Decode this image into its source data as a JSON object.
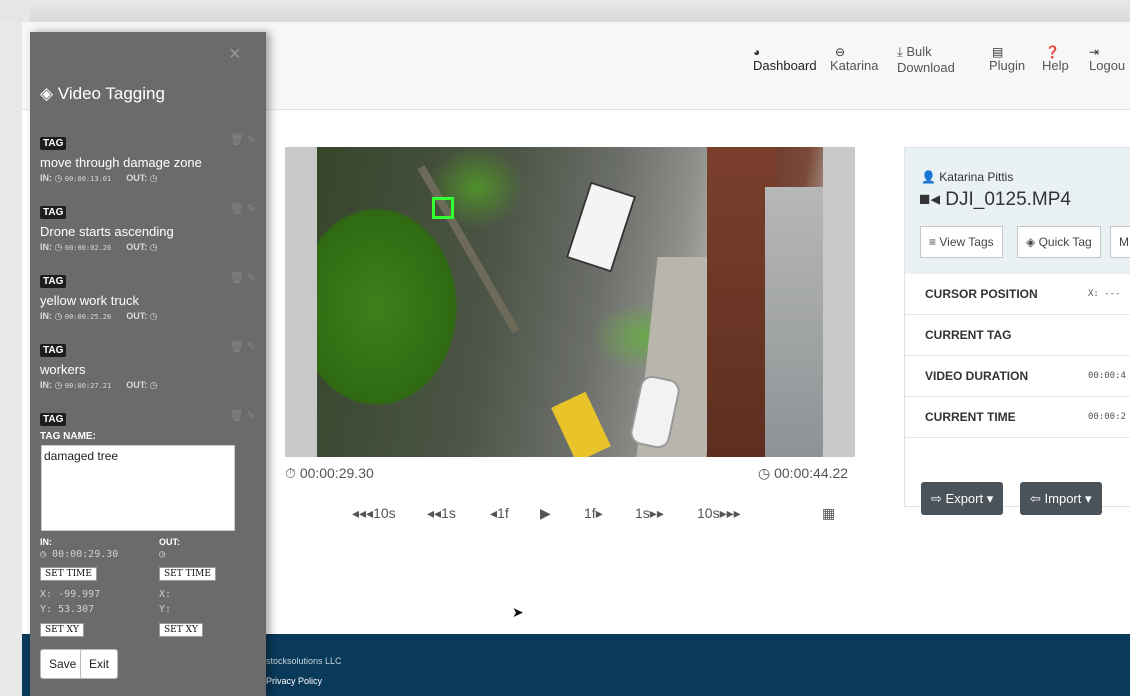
{
  "nav": {
    "dashboard": "Dashboard",
    "user": "Katarina",
    "bulk_line1": "Bulk",
    "bulk_line2": "Download",
    "plugin": "Plugin",
    "help": "Help",
    "logout": "Logou"
  },
  "sidebar": {
    "close": "×",
    "title": "Video Tagging",
    "tags": [
      {
        "badge": "TAG",
        "name": "move through damage zone",
        "in_label": "IN:",
        "in_time": "00:00:13.01",
        "out_label": "OUT:"
      },
      {
        "badge": "TAG",
        "name": "Drone starts ascending",
        "in_label": "IN:",
        "in_time": "00:00:02.26",
        "out_label": "OUT:"
      },
      {
        "badge": "TAG",
        "name": "yellow work truck",
        "in_label": "IN:",
        "in_time": "00:00:25.26",
        "out_label": "OUT:"
      },
      {
        "badge": "TAG",
        "name": "workers",
        "in_label": "IN:",
        "in_time": "00:00:27.21",
        "out_label": "OUT:"
      }
    ],
    "edit": {
      "badge": "TAG",
      "name_label": "TAG NAME:",
      "name_value": "damaged tree",
      "in_label": "IN:",
      "in_value": "00:00:29.30",
      "out_label": "OUT:",
      "set_time": "SET TIME",
      "x_label": "X:",
      "x_value": "-99.997",
      "y_label": "Y:",
      "y_value": "53.307",
      "set_xy": "SET XY",
      "save": "Save",
      "exit": "Exit"
    }
  },
  "player": {
    "current_time": "00:00:29.30",
    "total_time": "00:00:44.22",
    "controls": {
      "back10": "10s",
      "back1s": "1s",
      "back1f": "1f",
      "fwd1f": "1f",
      "fwd1s": "1s",
      "fwd10": "10s"
    }
  },
  "info": {
    "owner": "Katarina Pittis",
    "filename": "DJI_0125.MP4",
    "tabs": {
      "view_tags": "View Tags",
      "quick_tag": "Quick Tag",
      "more": "M"
    },
    "rows": {
      "cursor_label": "CURSOR POSITION",
      "cursor_value": "X: ---",
      "tag_label": "CURRENT TAG",
      "duration_label": "VIDEO DURATION",
      "duration_value": "00:00:4",
      "time_label": "CURRENT TIME",
      "time_value": "00:00:2"
    },
    "export": "Export",
    "import": "Import"
  },
  "footer": {
    "company": "stocksolutions LLC",
    "privacy": "Privacy Policy"
  }
}
